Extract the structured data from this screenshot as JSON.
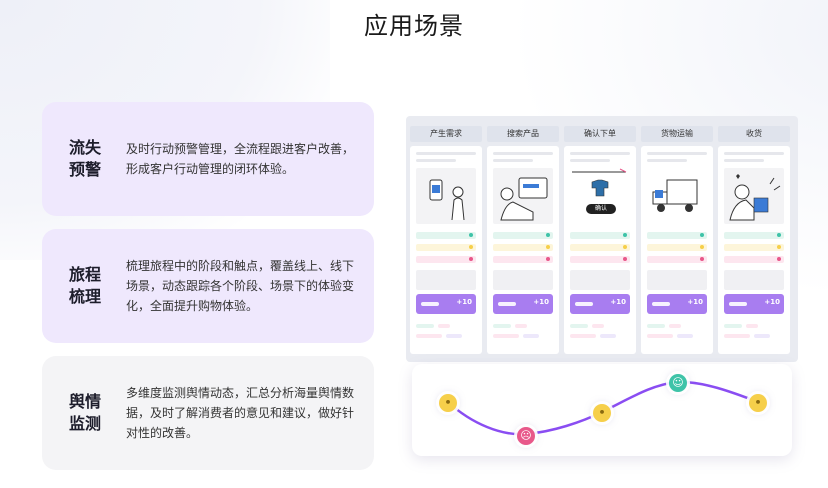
{
  "page": {
    "title": "应用场景"
  },
  "cards": [
    {
      "title_line1": "流失",
      "title_line2": "预警",
      "desc": "及时行动预警管理，全流程跟进客户改善，形成客户行动管理的闭环体验。"
    },
    {
      "title_line1": "旅程",
      "title_line2": "梳理",
      "desc": "梳理旅程中的阶段和触点，覆盖线上、线下场景，动态跟踪各个阶段、场景下的体验变化，全面提升购物体验。"
    },
    {
      "title_line1": "舆情",
      "title_line2": "监测",
      "desc": "多维度监测舆情动态，汇总分析海量舆情数据，及时了解消费者的意见和建议，做好针对性的改善。"
    }
  ],
  "journey": {
    "stages": [
      {
        "label": "产生需求",
        "score": "+10"
      },
      {
        "label": "搜索产品",
        "score": "+10"
      },
      {
        "label": "确认下单",
        "score": "+10"
      },
      {
        "label": "货物运输",
        "score": "+10"
      },
      {
        "label": "收货",
        "score": "+10"
      }
    ],
    "confirm_button": "确认"
  },
  "colors": {
    "accent": "#8a4df2",
    "card_purple": "#efe8fd",
    "card_gray": "#f4f4f6",
    "neutral_emoji": "#f6cf4a",
    "sad_emoji": "#e8588a",
    "happy_emoji": "#3ec3a8"
  },
  "icons": [
    "neutral-face-icon",
    "sad-face-icon",
    "happy-face-icon"
  ]
}
